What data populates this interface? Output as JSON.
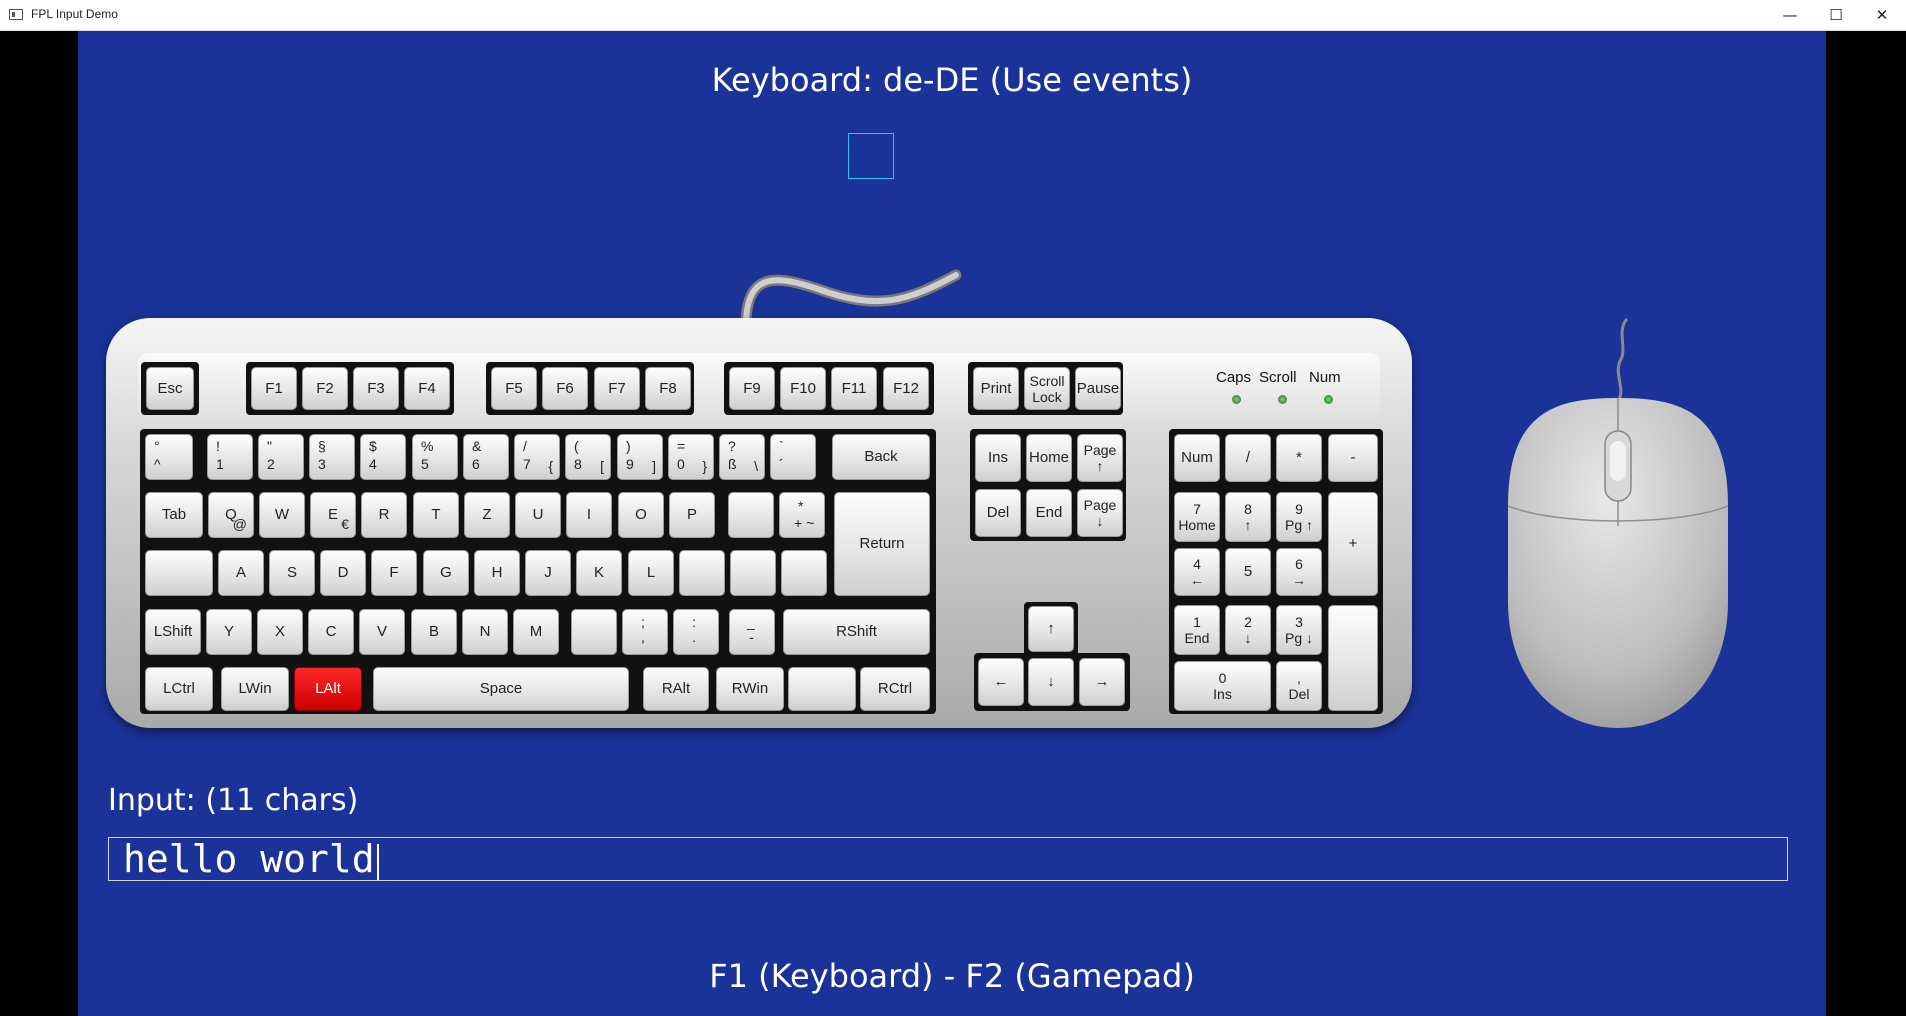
{
  "window": {
    "title": "FPL Input Demo",
    "minimize_glyph": "—",
    "maximize_glyph": "☐",
    "close_glyph": "✕"
  },
  "heading": "Keyboard: de-DE (Use events)",
  "keyboard": {
    "leds": {
      "caps": "Caps",
      "scroll": "Scroll",
      "num": "Num"
    },
    "keys": {
      "esc": "Esc",
      "f1": "F1",
      "f2": "F2",
      "f3": "F3",
      "f4": "F4",
      "f5": "F5",
      "f6": "F6",
      "f7": "F7",
      "f8": "F8",
      "f9": "F9",
      "f10": "F10",
      "f11": "F11",
      "f12": "F12",
      "print": "Print",
      "scroll_lock": "Scroll\nLock",
      "pause": "Pause",
      "grave_top": "°",
      "grave_bot": "^",
      "n1_top": "!",
      "n1_bot": "1",
      "n2_top": "\"",
      "n2_bot": "2",
      "n3_top": "§",
      "n3_bot": "3",
      "n4_top": "$",
      "n4_bot": "4",
      "n5_top": "%",
      "n5_bot": "5",
      "n6_top": "&",
      "n6_bot": "6",
      "n7_top": "/",
      "n7_bot": "7",
      "n7_alt": "{",
      "n8_top": "(",
      "n8_bot": "8",
      "n8_alt": "[",
      "n9_top": ")",
      "n9_bot": "9",
      "n9_alt": "]",
      "n0_top": "=",
      "n0_bot": "0",
      "n0_alt": "}",
      "ss_top": "?",
      "ss_bot": "ß",
      "ss_alt": "\\",
      "acc_top": "`",
      "acc_bot": "´",
      "back": "Back",
      "tab": "Tab",
      "q": "Q",
      "q_alt": "@",
      "w": "W",
      "e": "E",
      "e_alt": "€",
      "r": "R",
      "t": "T",
      "z": "Z",
      "u": "U",
      "i": "I",
      "o": "O",
      "p": "P",
      "plus_top": "*",
      "plus_bot": "+ ~",
      "return": "Return",
      "a": "A",
      "s": "S",
      "d": "D",
      "f": "F",
      "g": "G",
      "h": "H",
      "j": "J",
      "k": "K",
      "l": "L",
      "lshift": "LShift",
      "y": "Y",
      "x": "X",
      "c": "C",
      "v": "V",
      "b": "B",
      "n": "N",
      "m": "M",
      "comma_top": ";",
      "comma_bot": ",",
      "dot_top": ":",
      "dot_bot": ".",
      "minus_top": "_",
      "minus_bot": "-",
      "rshift": "RShift",
      "lctrl": "LCtrl",
      "lwin": "LWin",
      "lalt": "LAlt",
      "space": "Space",
      "ralt": "RAlt",
      "rwin": "RWin",
      "rctrl": "RCtrl",
      "ins": "Ins",
      "home": "Home",
      "pgup": "Page\n↑",
      "del": "Del",
      "end": "End",
      "pgdn": "Page\n↓",
      "up": "↑",
      "left": "←",
      "down": "↓",
      "right": "→",
      "num": "Num",
      "kp_div": "/",
      "kp_mul": "*",
      "kp_sub": "-",
      "kp7": "7\nHome",
      "kp8": "8\n↑",
      "kp9": "9\nPg ↑",
      "kp_add": "+",
      "kp4": "4\n←",
      "kp5": "5",
      "kp6": "6\n→",
      "kp1": "1\nEnd",
      "kp2": "2\n↓",
      "kp3": "3\nPg ↓",
      "kp0": "0\nIns",
      "kp_dec": ",\nDel"
    }
  },
  "input": {
    "label": "Input: (11 chars)",
    "value": "hello world"
  },
  "footer": "F1 (Keyboard) - F2 (Gamepad)"
}
